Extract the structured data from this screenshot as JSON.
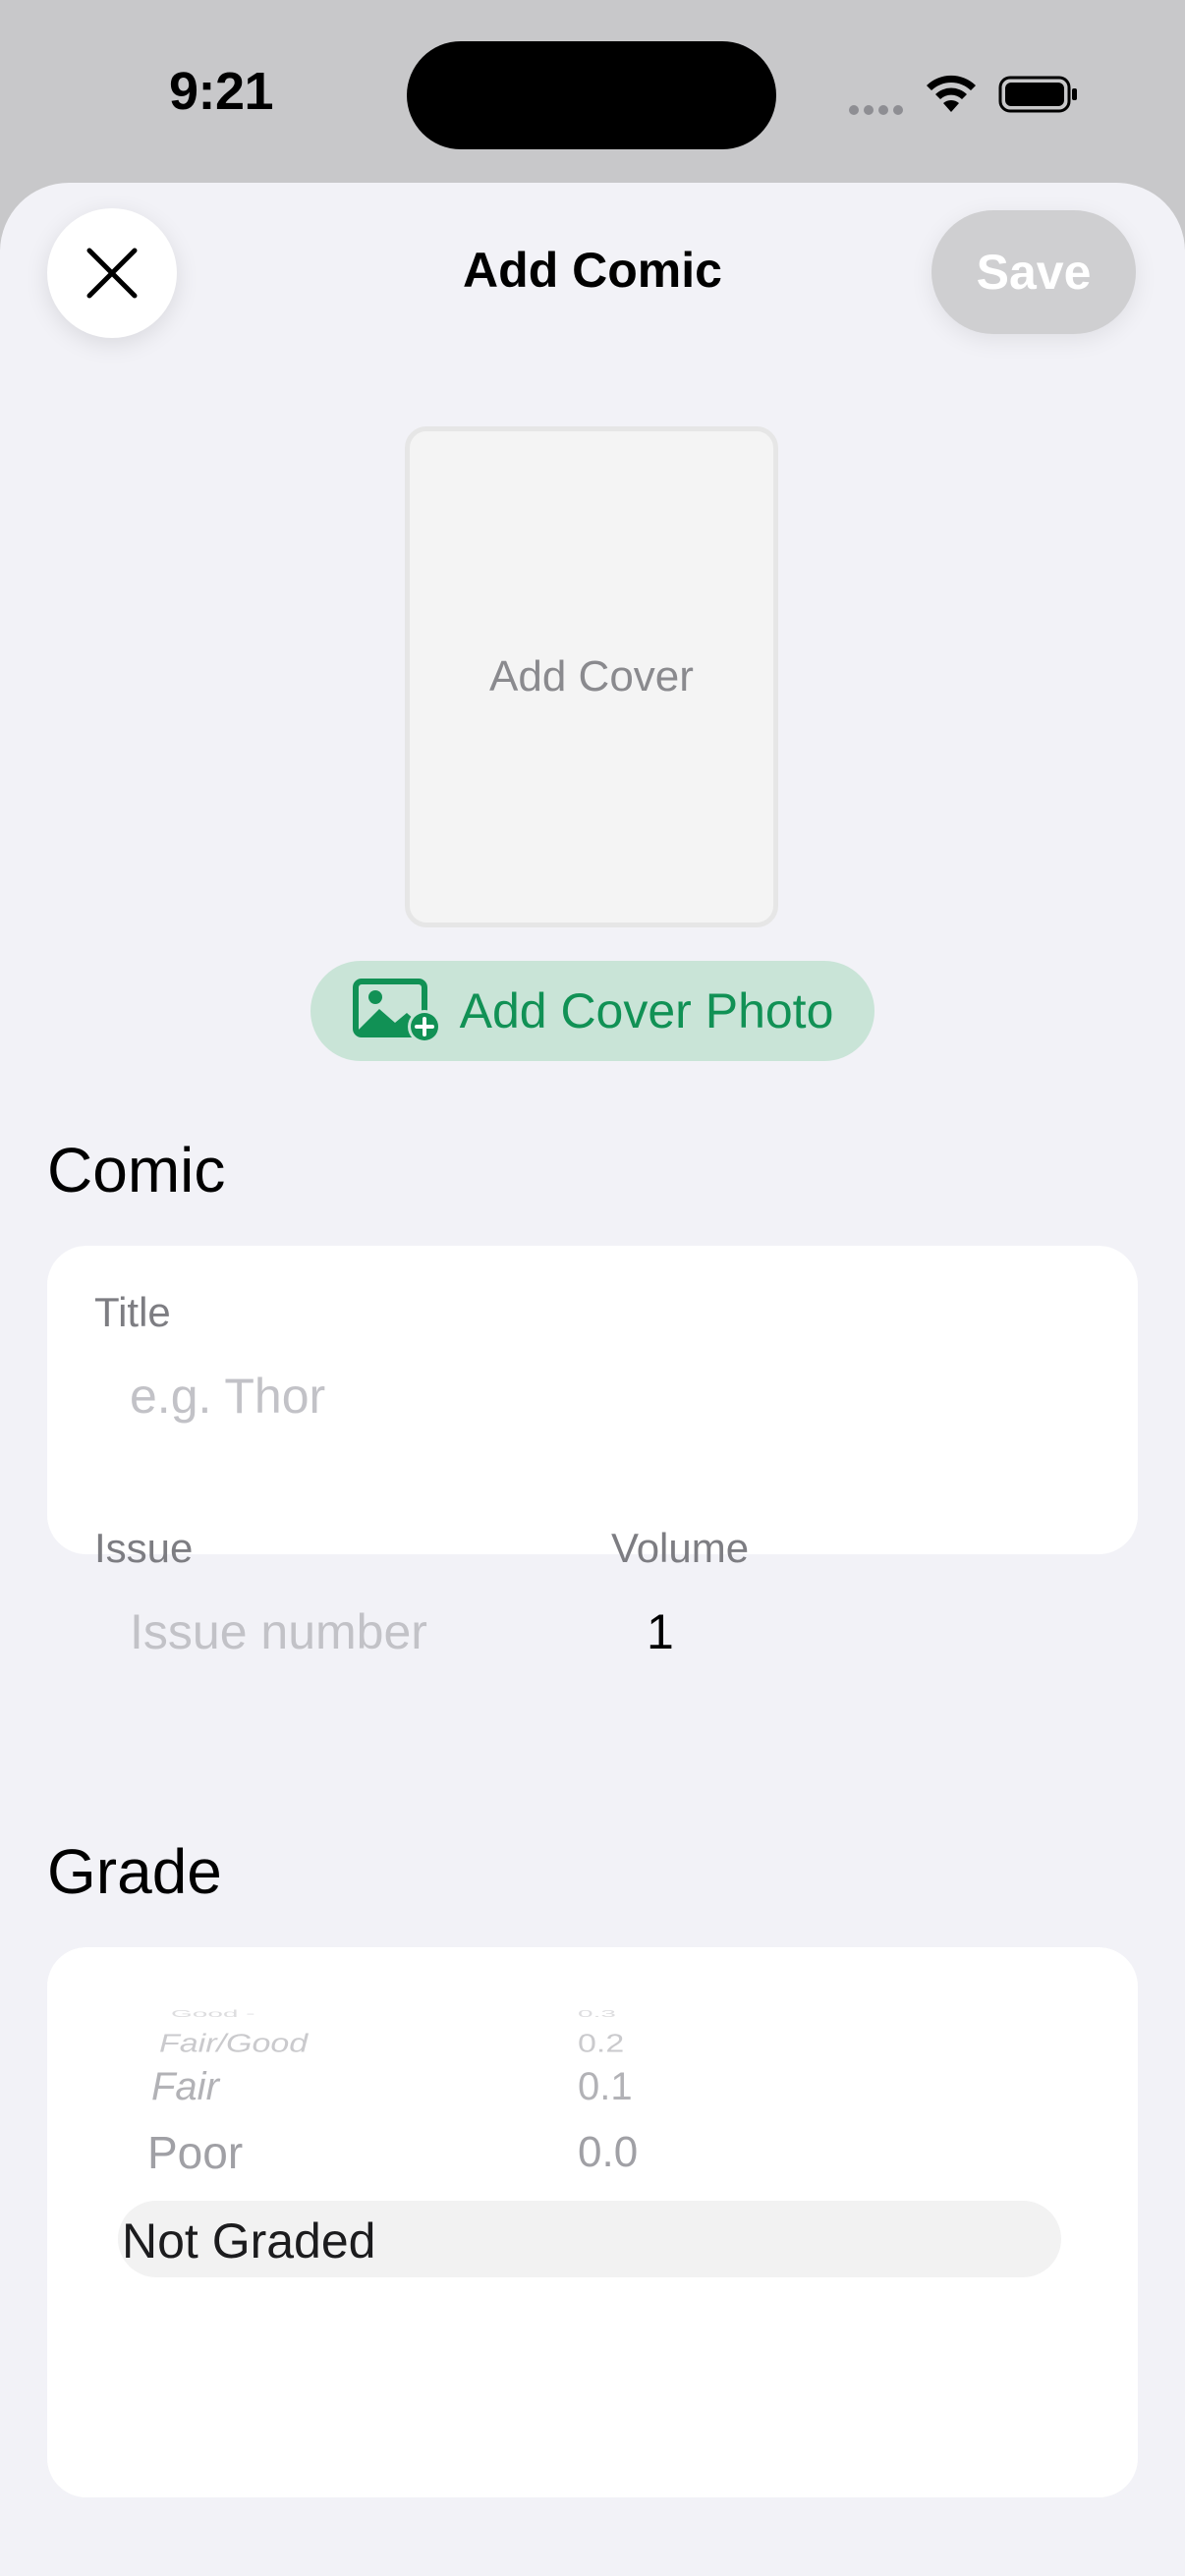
{
  "status_bar": {
    "time": "9:21"
  },
  "sheet": {
    "title": "Add Comic",
    "close_icon": "close-x-icon",
    "save_label": "Save"
  },
  "cover": {
    "placeholder_label": "Add Cover",
    "add_photo_label": "Add Cover Photo",
    "add_photo_icon": "photo-plus-icon",
    "accent_color": "#119155"
  },
  "comic_section": {
    "heading": "Comic",
    "title_label": "Title",
    "title_placeholder": "e.g. Thor",
    "issue_label": "Issue",
    "issue_placeholder": "Issue number",
    "volume_label": "Volume",
    "volume_value": "1"
  },
  "grade_section": {
    "heading": "Grade",
    "picker_items": [
      {
        "label": "Good -",
        "value": "0.3"
      },
      {
        "label": "Fair/Good",
        "value": "0.2"
      },
      {
        "label": "Fair",
        "value": "0.1"
      },
      {
        "label": "Poor",
        "value": "0.0"
      }
    ],
    "selected": "Not Graded"
  }
}
